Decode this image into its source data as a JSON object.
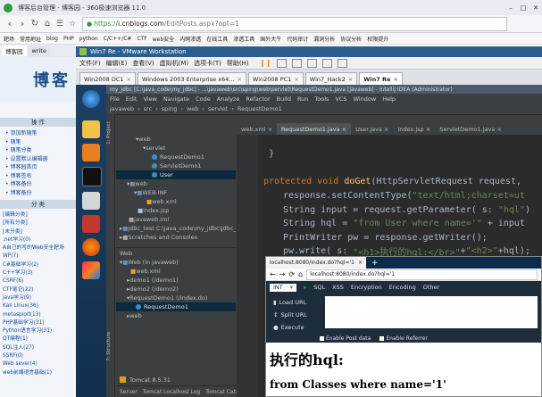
{
  "browser": {
    "window_title": "博客后台管理 - 博客园 - 360极速浏览器 11.0",
    "url_scheme": "https://",
    "url_host": "i.cnblogs.com",
    "url_path": "/EditPosts.aspx?opt=1",
    "bookmarks": [
      "靶场",
      "常用地址",
      "blog",
      "PHP",
      "python",
      "C/C++/C#",
      "CTF",
      "web安全",
      "内网渗透",
      "在线工具",
      "渗透工具",
      "国外大牛",
      "代码审计",
      "漏洞分析",
      "协议分析",
      "权限提升"
    ],
    "tabs": [
      "博客园",
      "write"
    ]
  },
  "blog": {
    "header": "博客",
    "section_ops": "操 作",
    "ops": [
      "添加新随笔",
      "随笔",
      "随笔分类",
      "设置默认编辑器",
      "博客园首页",
      "博客签名",
      "博客备份",
      "博客备份"
    ],
    "section_cats": "分 类",
    "cats": [
      "[编辑分类]",
      "[所有分类]",
      "[未分类]",
      ".net学习(0)",
      "A自己的写的Web安全靶场WP(7)",
      "C#基础学习(2)",
      "C++学习(3)",
      "CSRF(6)",
      "CTF笔记(22)",
      "java学习(9)",
      "Kali Linux(36)",
      "metasploit(13)",
      "PHP基础学习(31)",
      "Python语言学习(31)",
      "QT编程(1)",
      "SQL注入(27)",
      "SSRF(0)",
      "Web sever(4)",
      "web前端语言基础(1)"
    ]
  },
  "vmware": {
    "title": "Win7 Re - VMware Workstation",
    "menu": [
      "文件(F)",
      "编辑(E)",
      "查看(V)",
      "虚拟机(M)",
      "选项卡(T)",
      "帮助(H)"
    ],
    "tabs": [
      {
        "label": "Win2008 DC1",
        "active": false
      },
      {
        "label": "Windows 2003 Enterprise x64...",
        "active": false
      },
      {
        "label": "Win2008 PC1",
        "active": false
      },
      {
        "label": "Win7_Hack2",
        "active": false
      },
      {
        "label": "Win7 Re",
        "active": true
      }
    ]
  },
  "idea": {
    "title": "my_jdbc [C:\\java_code\\my_jdbc] - ...\\javaweb\\src\\sping\\web\\servlet\\RequestDemo1.java [javaweb] - IntelliJ IDEA (Administrator)",
    "menu": [
      "File",
      "Edit",
      "View",
      "Navigate",
      "Code",
      "Analyze",
      "Refactor",
      "Build",
      "Run",
      "Tools",
      "VCS",
      "Window",
      "Help"
    ],
    "breadcrumb": [
      "javaweb",
      "src",
      "sping",
      "web",
      "servlet",
      "RequestDemo1"
    ],
    "editor_tabs": [
      "web.xml",
      "RequestDemo1.java",
      "User.java",
      "index.jsp",
      "ServletDemo1.java"
    ],
    "tree": [
      {
        "label": "web",
        "indent": 1
      },
      {
        "label": "servlet",
        "indent": 2
      },
      {
        "label": "RequestDemo1",
        "indent": 3
      },
      {
        "label": "ServletDemo1",
        "indent": 3
      },
      {
        "label": "User",
        "indent": 3,
        "sel": true
      },
      {
        "label": "web",
        "indent": 0
      },
      {
        "label": "WEB-INF",
        "indent": 1
      },
      {
        "label": "web.xml",
        "indent": 2
      },
      {
        "label": "index.jsp",
        "indent": 1
      },
      {
        "label": "javaweb.iml",
        "indent": 0
      },
      {
        "label": "jdbc_test  C:\\java_code\\my_jdbc\\jdbc_te",
        "indent": -1
      },
      {
        "label": "Scratches and Consoles",
        "indent": -1
      }
    ],
    "web_panel_title": "Web",
    "web_tree": [
      {
        "label": "Web (in javaweb)",
        "indent": 0
      },
      {
        "label": "web.xml",
        "indent": 1
      },
      {
        "label": "demo1  (/demo1)",
        "indent": 1
      },
      {
        "label": "demo2  (/demo2)",
        "indent": 1
      },
      {
        "label": "RequestDemo1  (/index.do)",
        "indent": 1
      },
      {
        "label": "RequestDemo1",
        "indent": 2,
        "sel": true
      },
      {
        "label": "web",
        "indent": 1
      }
    ],
    "side_tab_project": "1: Project",
    "side_tab_structure": "7: Structure",
    "tomcat_label": "Tomcat 8.5.31",
    "bottom_tabs": [
      "Server",
      "Tomcat Localhost Log",
      "Tomcat Catalina Log"
    ],
    "code": [
      "}",
      "",
      "protected void doGet(HttpServletRequest request,",
      "    response.setContentType(\"text/html;charset=ut",
      "    String input = request.getParameter( s: \"hql\")",
      "    String hql = \"from User where name='\" + input",
      "    PrintWriter pw = response.getWriter();",
      "    pw.write( s: \"<h1>执行的hql:</br>\"+\"<h2>\"+hql);"
    ]
  },
  "popup": {
    "tab_title": "localhost:8080/index.do?hql='1",
    "url": "localhost:8080/index.do?hql='1",
    "hackbar_menu": [
      "INT",
      "SQL",
      "XSS",
      "Encryption",
      "Encoding",
      "Other"
    ],
    "actions": [
      "Load URL",
      "Split URL",
      "Execute"
    ],
    "chk_post": "Enable Post data",
    "chk_ref": "Enable Referrer",
    "h1": "执行的hql:",
    "h2": "from Classes where name='1'"
  },
  "colors": {
    "accent": "#2d5f8e",
    "editor_bg": "#2b2b2b",
    "ide_panel": "#3c3f41",
    "link": "#1a4aa0"
  }
}
